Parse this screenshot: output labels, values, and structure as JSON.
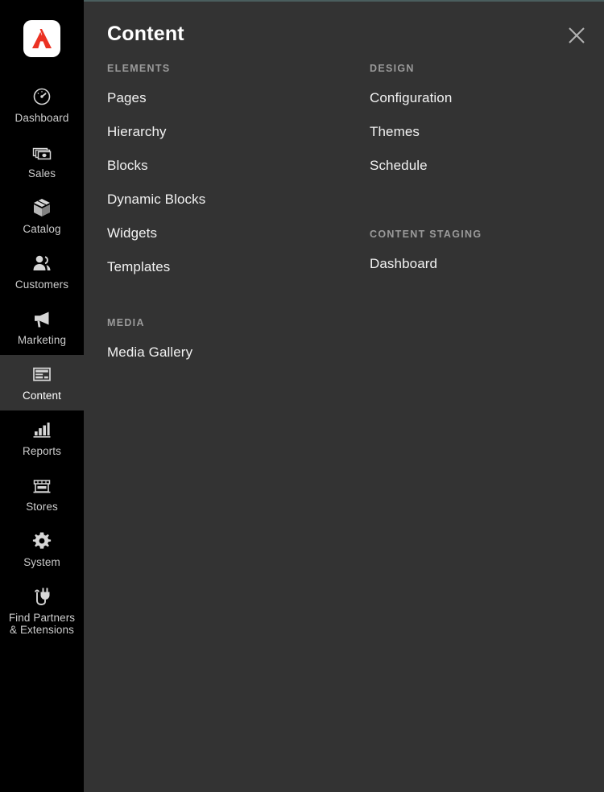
{
  "theme": {
    "sidebar_bg": "#000000",
    "panel_bg": "#333333",
    "active_item_bg": "#333333",
    "accent_top_line": "#4a5e5e",
    "logo_red": "#eb3223",
    "label_color": "#cccccc",
    "section_title_color": "#9b9b9b"
  },
  "sidebar": {
    "logo": {
      "name": "adobe-commerce-logo",
      "alt": "Adobe"
    },
    "items": [
      {
        "label": "Dashboard",
        "icon": "gauge-icon",
        "active": false
      },
      {
        "label": "Sales",
        "icon": "money-stack-icon",
        "active": false
      },
      {
        "label": "Catalog",
        "icon": "box-icon",
        "active": false
      },
      {
        "label": "Customers",
        "icon": "people-icon",
        "active": false
      },
      {
        "label": "Marketing",
        "icon": "megaphone-icon",
        "active": false
      },
      {
        "label": "Content",
        "icon": "layout-page-icon",
        "active": true
      },
      {
        "label": "Reports",
        "icon": "bar-chart-icon",
        "active": false
      },
      {
        "label": "Stores",
        "icon": "storefront-icon",
        "active": false
      },
      {
        "label": "System",
        "icon": "gear-icon",
        "active": false
      },
      {
        "label": "Find Partners\n& Extensions",
        "icon": "plug-icon",
        "active": false
      }
    ]
  },
  "panel": {
    "title": "Content",
    "close_icon": "close-icon",
    "close_label": "Close",
    "left_column": [
      {
        "title": "Elements",
        "items": [
          "Pages",
          "Hierarchy",
          "Blocks",
          "Dynamic Blocks",
          "Widgets",
          "Templates"
        ]
      },
      {
        "title": "Media",
        "items": [
          "Media Gallery"
        ]
      }
    ],
    "right_column": [
      {
        "title": "Design",
        "items": [
          "Configuration",
          "Themes",
          "Schedule"
        ]
      },
      {
        "title": "Content Staging",
        "items": [
          "Dashboard"
        ]
      }
    ]
  }
}
